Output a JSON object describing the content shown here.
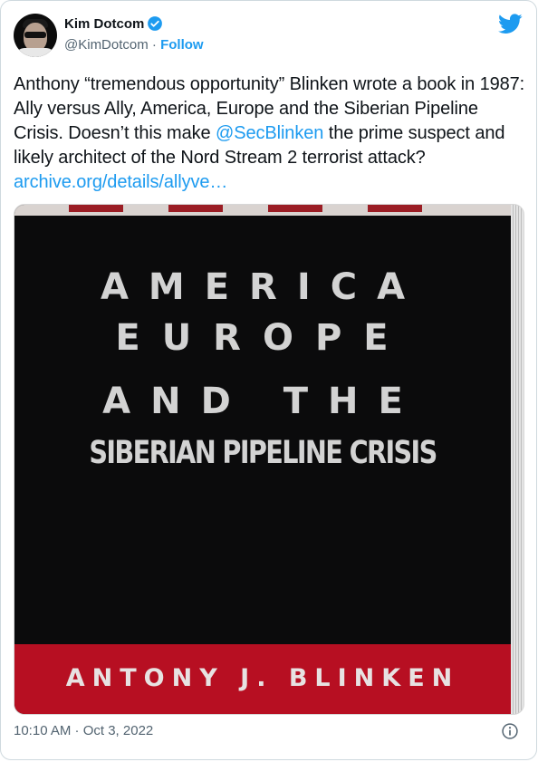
{
  "tweet": {
    "display_name": "Kim Dotcom",
    "handle": "@KimDotcom",
    "separator": "·",
    "follow_label": "Follow",
    "text_part1": "Anthony “tremendous opportunity” Blinken wrote a book in 1987: Ally versus Ally, America, Europe and the Siberian Pipeline Crisis. Doesn’t this make ",
    "mention": "@SecBlinken",
    "text_part2": " the prime suspect and likely architect of the Nord Stream 2 terrorist attack? ",
    "link": "archive.org/details/allyve…",
    "timestamp": "10:10 AM · Oct 3, 2022"
  },
  "image": {
    "line1": "AMERICA",
    "line2": "EUROPE",
    "line3": "AND THE",
    "line4": "SIBERIAN PIPELINE CRISIS",
    "author": "ANTONY J. BLINKEN"
  },
  "icons": {
    "verified": "verified-badge-icon",
    "twitter": "twitter-bird-icon",
    "info": "info-icon"
  },
  "colors": {
    "link": "#1d9bf0",
    "secondary_text": "#536471",
    "cover_background": "#0b0b0c",
    "cover_author_band": "#b70f22"
  }
}
